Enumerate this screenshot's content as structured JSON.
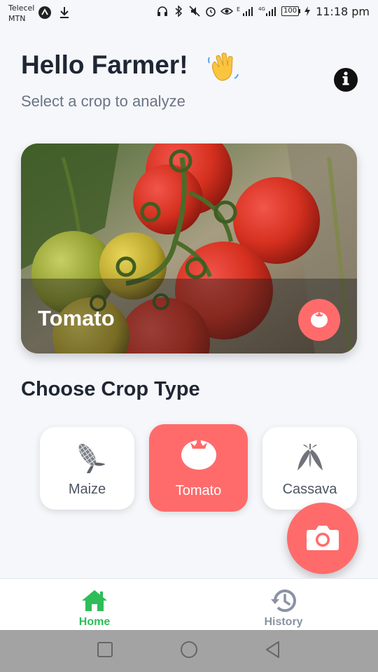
{
  "status_bar": {
    "carrier_line1": "Telecel",
    "carrier_line2": "MTN",
    "network_label_1": "E",
    "network_label_2": "4G",
    "battery": "100",
    "time": "11:18 pm",
    "icons": [
      "app-notification-icon",
      "download-icon",
      "headphones-icon",
      "bluetooth-icon",
      "mute-icon",
      "alarm-icon",
      "eye-icon",
      "signal-icon",
      "signal-icon",
      "battery-icon",
      "charging-icon"
    ]
  },
  "header": {
    "greeting": "Hello Farmer!",
    "wave_emoji": "waving-hand-icon",
    "subtitle": "Select a crop to analyze"
  },
  "hero": {
    "crop_name": "Tomato",
    "badge_icon": "tomato-icon"
  },
  "section_title": "Choose Crop Type",
  "crops": [
    {
      "label": "Maize",
      "icon": "maize-icon",
      "selected": false
    },
    {
      "label": "Tomato",
      "icon": "tomato-icon",
      "selected": true
    },
    {
      "label": "Cassava",
      "icon": "cassava-icon",
      "selected": false
    }
  ],
  "fab": {
    "icon": "camera-icon"
  },
  "bottom_nav": {
    "home_label": "Home",
    "history_label": "History",
    "active": "Home"
  },
  "colors": {
    "accent": "#ff6b6b",
    "nav_active": "#2ebd59",
    "nav_inactive": "#8a93a3",
    "text_dark": "#1f2633",
    "text_muted": "#6b7484",
    "background": "#f5f7fb"
  }
}
